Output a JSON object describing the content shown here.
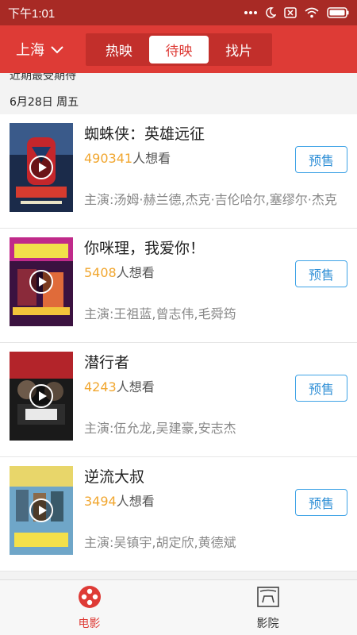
{
  "status_bar": {
    "time": "下午1:01"
  },
  "header": {
    "city": "上海",
    "tabs": [
      {
        "label": "热映",
        "active": false
      },
      {
        "label": "待映",
        "active": true
      },
      {
        "label": "找片",
        "active": false
      }
    ]
  },
  "list": {
    "section_title": "近期最受期待",
    "date_header": "6月28日 周五",
    "presale_label": "预售",
    "want_suffix": "人想看",
    "movies": [
      {
        "title": "蜘蛛侠：英雄远征",
        "want_count": "490341",
        "cast": "主演:汤姆·赫兰德,杰克·吉伦哈尔,塞缪尔·杰克"
      },
      {
        "title": "你咪理，我爱你！",
        "want_count": "5408",
        "cast": "主演:王祖蓝,曾志伟,毛舜筠"
      },
      {
        "title": "潜行者",
        "want_count": "4243",
        "cast": "主演:伍允龙,吴建豪,安志杰"
      },
      {
        "title": "逆流大叔",
        "want_count": "3494",
        "cast": "主演:吴镇宇,胡定欣,黄德斌"
      }
    ]
  },
  "bottom_nav": {
    "items": [
      {
        "label": "电影",
        "active": true,
        "icon": "film-reel-icon"
      },
      {
        "label": "影院",
        "active": false,
        "icon": "cinema-screen-icon"
      }
    ]
  },
  "colors": {
    "brand_red": "#de3b36",
    "status_bar": "#a82a25",
    "want_count": "#f1a62e",
    "presale_blue": "#3fa3e6"
  }
}
